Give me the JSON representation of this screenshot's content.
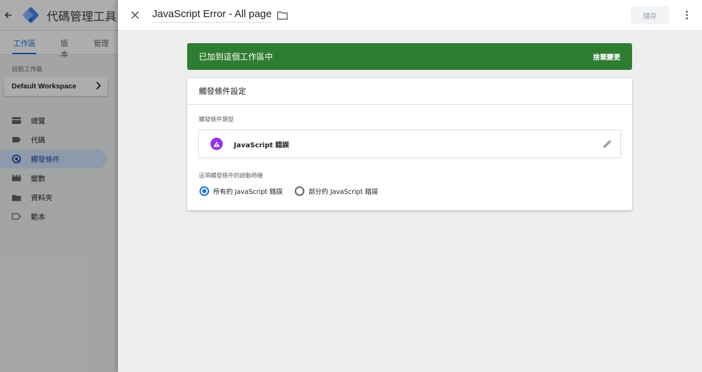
{
  "app": {
    "title": "代碼管理工具",
    "tabs": [
      "工作區",
      "版本",
      "管理"
    ],
    "workspace_label": "目前工作區",
    "workspace_name": "Default Workspace",
    "nav": [
      {
        "label": "總覽",
        "icon": "overview-icon"
      },
      {
        "label": "代碼",
        "icon": "tag-icon"
      },
      {
        "label": "觸發條件",
        "icon": "trigger-icon",
        "active": true
      },
      {
        "label": "變數",
        "icon": "variables-icon"
      },
      {
        "label": "資料夾",
        "icon": "folder-icon"
      },
      {
        "label": "範本",
        "icon": "template-icon"
      }
    ]
  },
  "panel": {
    "title": "JavaScript Error - All page",
    "save_label": "儲存",
    "banner": {
      "text": "已加到這個工作區中",
      "action": "捨棄變更"
    },
    "card": {
      "heading": "觸發條件設定",
      "type_label": "觸發條件類型",
      "type_name": "JavaScript 錯誤",
      "fire_label": "這項觸發條件的啟動時機",
      "options": [
        {
          "label": "所有的 JavaScript 錯誤",
          "selected": true
        },
        {
          "label": "部分的 JavaScript 錯誤",
          "selected": false
        }
      ]
    }
  },
  "colors": {
    "accent": "#1a73e8",
    "banner": "#2e7d32",
    "trigger_type": "#9334e6"
  }
}
